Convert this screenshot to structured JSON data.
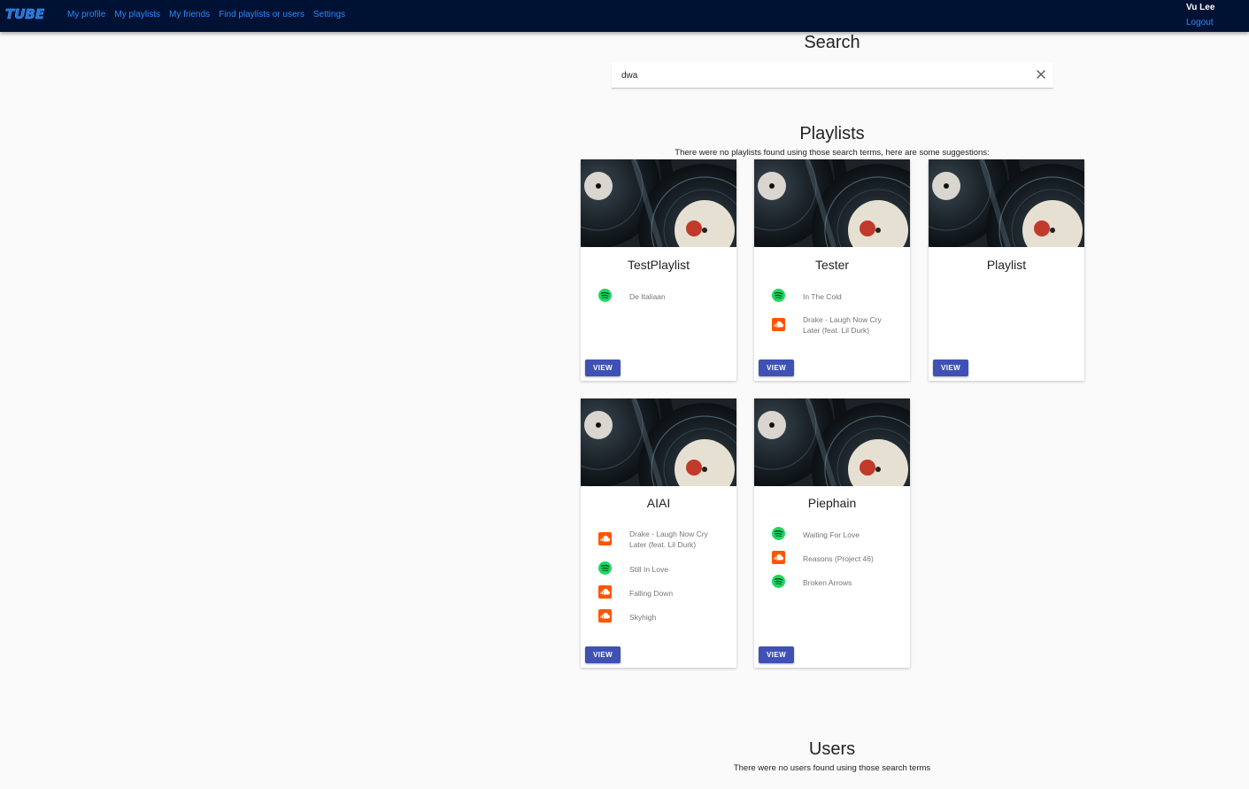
{
  "header": {
    "logo": "TUBE",
    "nav": [
      "My profile",
      "My playlists",
      "My friends",
      "Find playlists or users",
      "Settings"
    ],
    "user_name": "Vu Lee",
    "logout": "Logout"
  },
  "search": {
    "heading": "Search",
    "value": "dwa",
    "clear_icon": "close-icon"
  },
  "playlists": {
    "heading": "Playlists",
    "note": "There were no playlists found using those search terms, here are some suggestions:",
    "view_label": "VIEW",
    "cards": [
      {
        "title": "TestPlaylist",
        "tracks": [
          {
            "source": "spotify",
            "name": "De Italiaan"
          }
        ]
      },
      {
        "title": "Tester",
        "tracks": [
          {
            "source": "spotify",
            "name": "In The Cold"
          },
          {
            "source": "soundcloud",
            "name": "Drake - Laugh Now Cry Later (feat. Lil Durk)"
          }
        ]
      },
      {
        "title": "Playlist",
        "tracks": []
      },
      {
        "title": "AIAI",
        "tracks": [
          {
            "source": "soundcloud",
            "name": "Drake - Laugh Now Cry Later (feat. Lil Durk)"
          },
          {
            "source": "spotify",
            "name": "Still In Love"
          },
          {
            "source": "soundcloud",
            "name": "Falling Down"
          },
          {
            "source": "soundcloud",
            "name": "Skyhigh"
          }
        ]
      },
      {
        "title": "Piephain",
        "tracks": [
          {
            "source": "spotify",
            "name": "Waiting For Love"
          },
          {
            "source": "soundcloud",
            "name": "Reasons (Project 46)"
          },
          {
            "source": "spotify",
            "name": "Broken Arrows"
          }
        ]
      }
    ]
  },
  "users": {
    "heading": "Users",
    "note": "There were no users found using those search terms"
  },
  "colors": {
    "topbar": "#001233",
    "link": "#2b88ff",
    "button": "#3f51b5",
    "spotify": "#1ed760",
    "soundcloud": "#ff5500"
  }
}
